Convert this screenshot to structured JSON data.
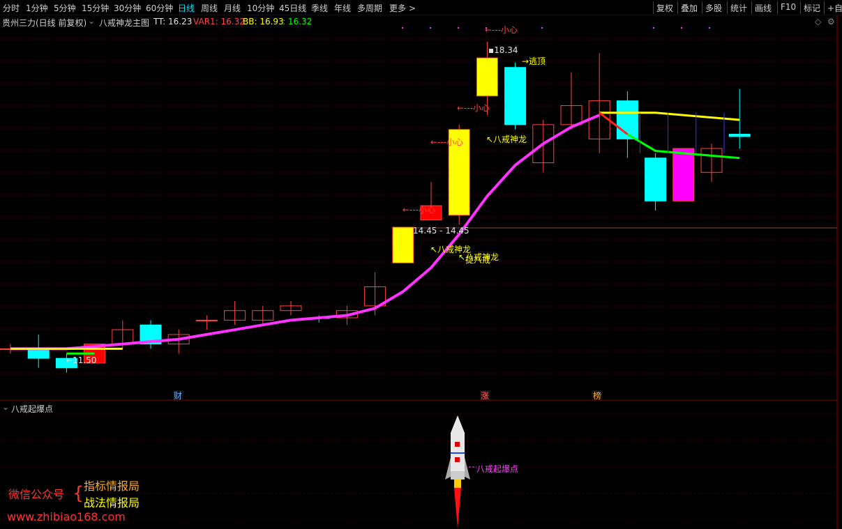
{
  "toolbar": {
    "periods": [
      "分时",
      "1分钟",
      "5分钟",
      "15分钟",
      "30分钟",
      "60分钟",
      "日线",
      "周线",
      "月线",
      "10分钟",
      "45日线",
      "季线",
      "年线",
      "多周期",
      "更多 >"
    ],
    "active": "日线",
    "right_tools": [
      "复权",
      "叠加",
      "多股",
      "统计",
      "画线",
      "F10",
      "标记",
      "+自选"
    ]
  },
  "main_header": {
    "stock": "贵州三力(日线 前复权)",
    "indicator": "八戒神龙主图",
    "tt_label": "TT: 16.23",
    "var1_label": "VAR1: 16.32",
    "bb_label": "BB: 16.93",
    "bb2_label": ": 16.32"
  },
  "annotations": {
    "high_price": "18.34",
    "low_price": "11.50",
    "range_label": "14.45 - 14.45",
    "top_escape": "逃顶",
    "careful": "小心",
    "bajie_long": "八戒神龙",
    "catch_long": "捉八戒",
    "careful_top": "小心"
  },
  "date_markers": [
    {
      "label": "财",
      "color": "#66aaff"
    },
    {
      "label": "涨",
      "color": "#ff6666"
    },
    {
      "label": "榜",
      "color": "#ffaa33"
    }
  ],
  "sub_header": {
    "indicator": "八戒起爆点",
    "rocket_label": "八戒起爆点"
  },
  "watermark": {
    "left": "微信公众号",
    "line1": "指标情报局",
    "line2": "战法情报局",
    "url": "www.zhibiao168.com"
  },
  "colors": {
    "up": "#ff3333",
    "down": "#00ffff",
    "ma": "#ff33ff",
    "bg": "#000000"
  },
  "chart_data": {
    "type": "candlestick",
    "candles": [
      {
        "o": 11.9,
        "c": 11.9,
        "h": 12.0,
        "l": 11.8,
        "color": "flat"
      },
      {
        "o": 11.9,
        "c": 11.7,
        "h": 12.2,
        "l": 11.5,
        "color": "cyan"
      },
      {
        "o": 11.7,
        "c": 11.5,
        "h": 11.8,
        "l": 11.4,
        "color": "cyan"
      },
      {
        "o": 11.6,
        "c": 12.0,
        "h": 12.0,
        "l": 11.6,
        "color": "red"
      },
      {
        "o": 12.0,
        "c": 12.3,
        "h": 12.5,
        "l": 11.9,
        "color": "hollow"
      },
      {
        "o": 12.4,
        "c": 12.0,
        "h": 12.5,
        "l": 11.9,
        "color": "cyan"
      },
      {
        "o": 12.0,
        "c": 12.2,
        "h": 12.3,
        "l": 11.8,
        "color": "hollow"
      },
      {
        "o": 12.5,
        "c": 12.5,
        "h": 12.6,
        "l": 12.3,
        "color": "hollow"
      },
      {
        "o": 12.5,
        "c": 12.7,
        "h": 12.9,
        "l": 12.4,
        "color": "hollow"
      },
      {
        "o": 12.5,
        "c": 12.7,
        "h": 12.8,
        "l": 12.4,
        "color": "hollow"
      },
      {
        "o": 12.7,
        "c": 12.8,
        "h": 12.9,
        "l": 12.6,
        "color": "hollow"
      },
      {
        "o": 12.55,
        "c": 12.55,
        "h": 12.6,
        "l": 12.45,
        "color": "cyan"
      },
      {
        "o": 12.55,
        "c": 12.7,
        "h": 12.8,
        "l": 12.4,
        "color": "hollow"
      },
      {
        "o": 12.8,
        "c": 13.2,
        "h": 13.5,
        "l": 12.6,
        "color": "hollow"
      },
      {
        "o": 13.7,
        "c": 14.45,
        "h": 14.45,
        "l": 13.7,
        "color": "yellow"
      },
      {
        "o": 14.6,
        "c": 14.9,
        "h": 15.4,
        "l": 14.6,
        "color": "red"
      },
      {
        "o": 14.7,
        "c": 16.5,
        "h": 16.6,
        "l": 14.5,
        "color": "yellow"
      },
      {
        "o": 17.2,
        "c": 18.0,
        "h": 18.34,
        "l": 16.8,
        "color": "yellow"
      },
      {
        "o": 17.8,
        "c": 16.6,
        "h": 17.9,
        "l": 16.5,
        "color": "cyan"
      },
      {
        "o": 15.8,
        "c": 16.6,
        "h": 16.7,
        "l": 15.6,
        "color": "hollow"
      },
      {
        "o": 16.6,
        "c": 17.0,
        "h": 17.7,
        "l": 16.5,
        "color": "hollow"
      },
      {
        "o": 16.3,
        "c": 17.1,
        "h": 18.1,
        "l": 16.0,
        "color": "hollow"
      },
      {
        "o": 17.1,
        "c": 16.3,
        "h": 17.3,
        "l": 15.9,
        "color": "cyan"
      },
      {
        "o": 15.9,
        "c": 15.0,
        "h": 16.0,
        "l": 14.8,
        "color": "cyan"
      },
      {
        "o": 15.0,
        "c": 16.1,
        "h": 16.1,
        "l": 15.0,
        "color": "magenta"
      },
      {
        "o": 15.6,
        "c": 16.1,
        "h": 16.2,
        "l": 15.4,
        "color": "hollow"
      },
      {
        "o": 16.4,
        "c": 16.35,
        "h": 17.35,
        "l": 16.1,
        "color": "cyan"
      }
    ],
    "ma": [
      11.9,
      11.9,
      11.9,
      11.95,
      12.0,
      12.05,
      12.1,
      12.2,
      12.3,
      12.4,
      12.5,
      12.55,
      12.6,
      12.75,
      13.1,
      13.6,
      14.3,
      15.1,
      15.75,
      16.2,
      16.55,
      16.8,
      16.85,
      16.8,
      16.7,
      16.6,
      16.5
    ],
    "ylim": [
      11.0,
      18.6
    ]
  }
}
